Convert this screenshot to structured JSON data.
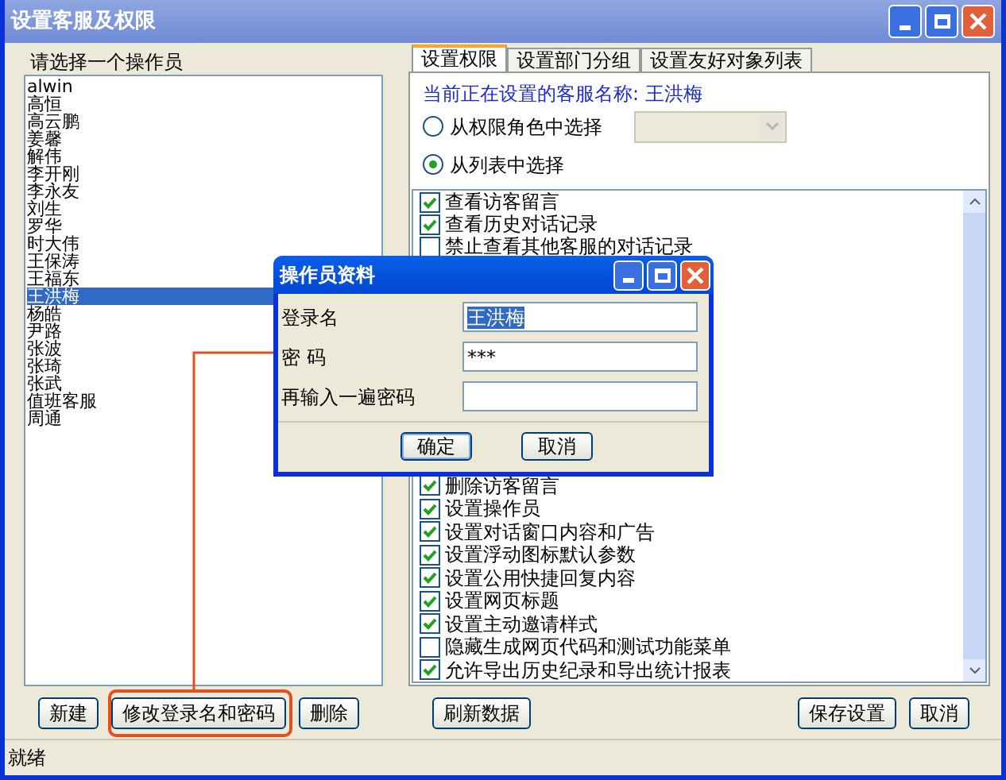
{
  "window": {
    "title": "设置客服及权限"
  },
  "operators": {
    "label": "请选择一个操作员",
    "items": [
      {
        "name": "alwin",
        "selected": false
      },
      {
        "name": "高恒",
        "selected": false
      },
      {
        "name": "高云鹏",
        "selected": false
      },
      {
        "name": "姜馨",
        "selected": false
      },
      {
        "name": "解伟",
        "selected": false
      },
      {
        "name": "李开刚",
        "selected": false
      },
      {
        "name": "李永友",
        "selected": false
      },
      {
        "name": "刘生",
        "selected": false
      },
      {
        "name": "罗华",
        "selected": false
      },
      {
        "name": "时大伟",
        "selected": false
      },
      {
        "name": "王保涛",
        "selected": false
      },
      {
        "name": "王福东",
        "selected": false
      },
      {
        "name": "王洪梅",
        "selected": true
      },
      {
        "name": "杨皓",
        "selected": false
      },
      {
        "name": "尹路",
        "selected": false
      },
      {
        "name": "张波",
        "selected": false
      },
      {
        "name": "张琦",
        "selected": false
      },
      {
        "name": "张武",
        "selected": false
      },
      {
        "name": "值班客服",
        "selected": false
      },
      {
        "name": "周通",
        "selected": false
      }
    ]
  },
  "tabs": [
    {
      "label": "设置权限",
      "selected": true
    },
    {
      "label": "设置部门分组",
      "selected": false
    },
    {
      "label": "设置友好对象列表",
      "selected": false
    }
  ],
  "current_name": "当前正在设置的客服名称: 王洪梅",
  "role_options": [
    {
      "label": "从权限角色中选择",
      "selected": false,
      "kind": "dropdown"
    },
    {
      "label": "从列表中选择",
      "selected": true,
      "kind": "plain"
    }
  ],
  "role_dropdown": {
    "disabled": true
  },
  "permissions_top": [
    {
      "label": "查看访客留言",
      "checked": true
    },
    {
      "label": "查看历史对话记录",
      "checked": true
    },
    {
      "label": "禁止查看其他客服的对话记录",
      "checked": false
    }
  ],
  "permissions_bottom": [
    {
      "label": "删除访客留言",
      "checked": true
    },
    {
      "label": "设置操作员",
      "checked": true
    },
    {
      "label": "设置对话窗口内容和广告",
      "checked": true
    },
    {
      "label": "设置浮动图标默认参数",
      "checked": true
    },
    {
      "label": "设置公用快捷回复内容",
      "checked": true
    },
    {
      "label": "设置网页标题",
      "checked": true
    },
    {
      "label": "设置主动邀请样式",
      "checked": true
    },
    {
      "label": "隐藏生成网页代码和测试功能菜单",
      "checked": false
    },
    {
      "label": "允许导出历史纪录和导出统计报表",
      "checked": true
    }
  ],
  "left_buttons": [
    {
      "label": "新建"
    },
    {
      "label": "修改登录名和密码"
    },
    {
      "label": "删除"
    }
  ],
  "refresh_button": "刷新数据",
  "right_buttons": [
    "保存设置",
    "取消"
  ],
  "status_bar": "就绪",
  "dialog": {
    "title": "操作员资料",
    "fields": [
      {
        "label": "登录名",
        "value": "王洪梅",
        "text_selected": true
      },
      {
        "label": "密 码",
        "value": "***",
        "text_selected": false
      },
      {
        "label": "再输入一遍密码"
      }
    ],
    "buttons": [
      {
        "label": "确定",
        "default": true
      },
      {
        "label": "取消",
        "default": false
      }
    ]
  }
}
